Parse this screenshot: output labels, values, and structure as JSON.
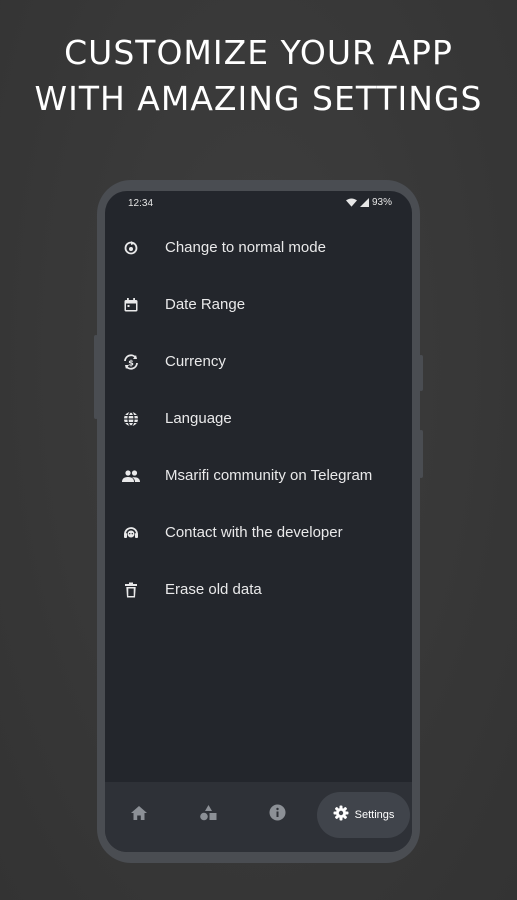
{
  "headline": {
    "line1": "CUSTOMIZE YOUR APP",
    "line2": "WITH AMAZING SETTINGS"
  },
  "statusbar": {
    "time": "12:34",
    "battery": "93%"
  },
  "menu": [
    {
      "label": "Change to normal mode",
      "icon": "mode-switch-icon"
    },
    {
      "label": "Date Range",
      "icon": "calendar-icon"
    },
    {
      "label": "Currency",
      "icon": "currency-exchange-icon"
    },
    {
      "label": "Language",
      "icon": "globe-icon"
    },
    {
      "label": "Msarifi community on Telegram",
      "icon": "people-icon"
    },
    {
      "label": "Contact with the developer",
      "icon": "support-agent-icon"
    },
    {
      "label": "Erase old data",
      "icon": "trash-icon"
    }
  ],
  "bottomnav": {
    "items": [
      "home-icon",
      "shapes-icon",
      "info-icon",
      "gear-icon"
    ],
    "settings_label": "Settings"
  },
  "colors": {
    "background": "#3a3a3a",
    "phone_frame": "#4a4d52",
    "screen": "#23262c",
    "bottom_nav": "#2e3137",
    "active_pill": "#40444b",
    "text": "#e9e9ea"
  }
}
